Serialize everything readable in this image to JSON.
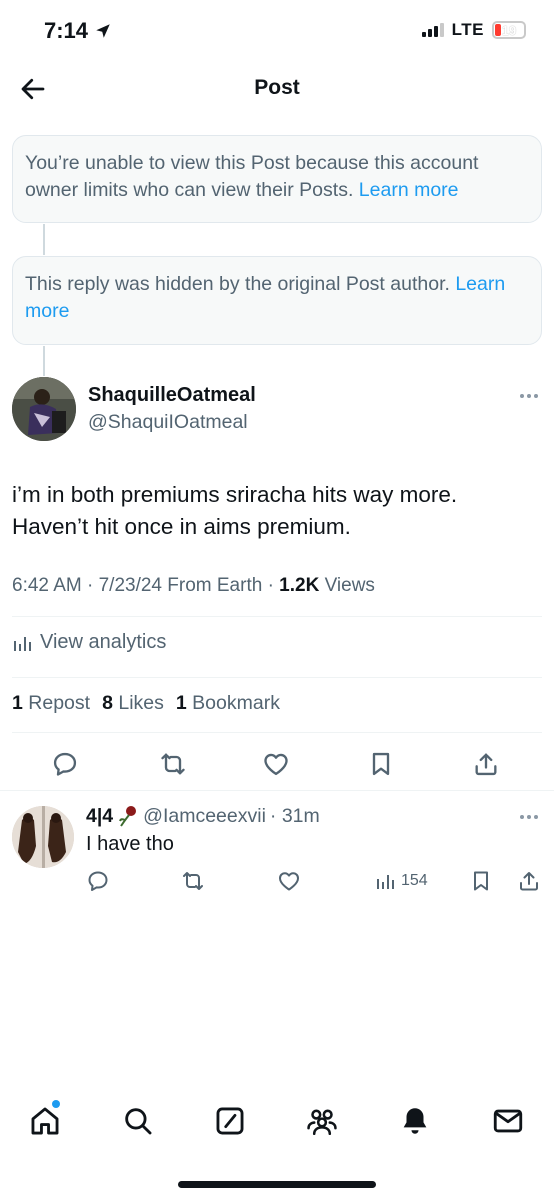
{
  "status_bar": {
    "time": "7:14",
    "network": "LTE",
    "battery": "19",
    "battery_level": 0.19,
    "colors": {
      "battery_low": "#ff3b30"
    }
  },
  "header": {
    "title": "Post"
  },
  "notices": [
    {
      "text": "You’re unable to view this Post because this account owner limits who can view their Posts. ",
      "link": "Learn more"
    },
    {
      "text": "This reply was hidden by the original Post author. ",
      "link": "Learn more"
    }
  ],
  "post": {
    "author_name": "ShaquilleOatmeal",
    "author_handle": "@ShaquiIOatmeal",
    "text_line1": "i’m in both premiums sriracha hits way more.",
    "text_line2": "Haven’t hit once in aims premium.",
    "meta_time": "6:42 AM · 7/23/24 From Earth · ",
    "views_count": "1.2K",
    "views_label": " Views",
    "analytics_label": "View analytics",
    "reposts_count": "1",
    "reposts_label": "Repost",
    "likes_count": "8",
    "likes_label": "Likes",
    "bookmarks_count": "1",
    "bookmarks_label": "Bookmark"
  },
  "reply": {
    "author_name": "4|4",
    "author_handle": "@Iamceeexvii",
    "time": "· 31m",
    "text": "I have tho",
    "views": "154"
  },
  "icons": {
    "back": "arrow-left-icon",
    "nav": [
      "home-icon",
      "search-icon",
      "grok-icon",
      "communities-icon",
      "notifications-icon",
      "messages-icon"
    ]
  },
  "colors": {
    "accent": "#1d9bf0",
    "text_primary": "#0f1419",
    "text_secondary": "#536471"
  }
}
